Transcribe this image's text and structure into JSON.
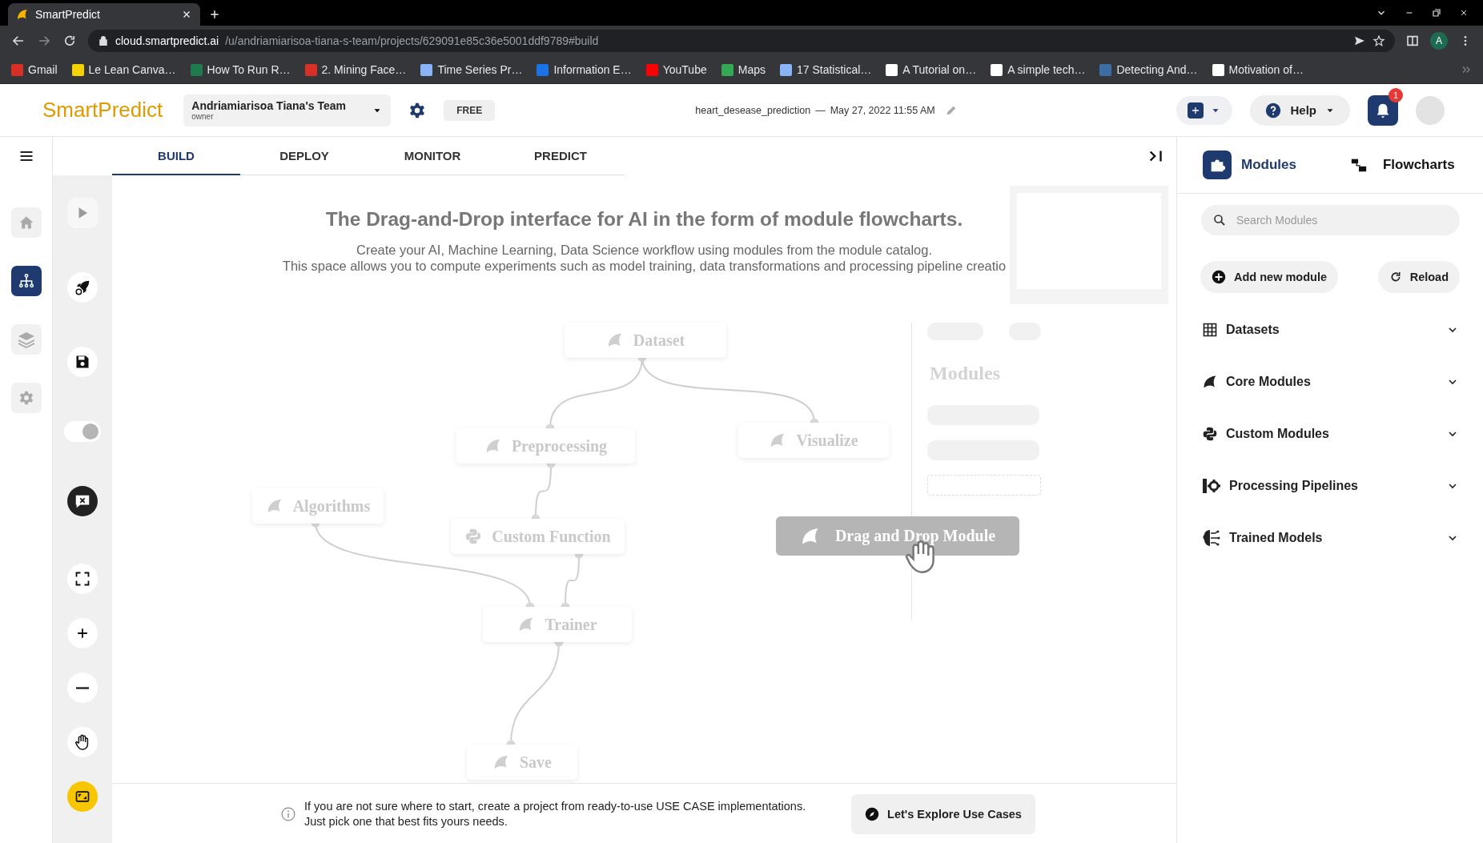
{
  "browser": {
    "tabs": [
      {
        "title": "SmartPredict",
        "selected": true
      }
    ],
    "url_host": "cloud.smartpredict.ai",
    "url_path": "/u/andriamiarisoa-tiana-s-team/projects/629091e85c36e5001ddf9789#build",
    "profile_initial": "A",
    "bookmarks": [
      "Gmail",
      "Le Lean Canva…",
      "How To Run R…",
      "2. Mining Face…",
      "Time Series Pr…",
      "Information E…",
      "YouTube",
      "Maps",
      "17 Statistical…",
      "A Tutorial on…",
      "A simple tech…",
      "Detecting And…",
      "Motivation of…"
    ]
  },
  "header": {
    "logo": "SmartPredict",
    "team": "Andriamiarisoa Tiana's Team",
    "role": "owner",
    "plan": "FREE",
    "project": "heart_desease_prediction",
    "separator": "—",
    "date": "May 27, 2022 11:55 AM",
    "help": "Help",
    "notifications": "1"
  },
  "nav": [
    {
      "kind": "home",
      "selected": false
    },
    {
      "kind": "flowchart",
      "selected": true
    },
    {
      "kind": "layers",
      "selected": false
    },
    {
      "kind": "settings",
      "selected": false
    }
  ],
  "tabs": [
    {
      "label": "BUILD",
      "selected": true
    },
    {
      "label": "DEPLOY",
      "selected": false
    },
    {
      "label": "MONITOR",
      "selected": false
    },
    {
      "label": "PREDICT",
      "selected": false
    }
  ],
  "toolbar": [
    {
      "kind": "run",
      "disabled": true,
      "active": false
    },
    {
      "kind": "deploy",
      "disabled": false,
      "active": false
    },
    {
      "kind": "save",
      "disabled": false,
      "active": false
    },
    {
      "kind": "switch",
      "on": true
    },
    {
      "kind": "comments",
      "disabled": false,
      "active": false
    },
    {
      "kind": "fullscreen",
      "disabled": false,
      "active": false
    },
    {
      "kind": "zoom-in",
      "disabled": false,
      "active": false
    },
    {
      "kind": "zoom-out",
      "disabled": false,
      "active": false
    },
    {
      "kind": "pan",
      "disabled": false,
      "active": false
    },
    {
      "kind": "fit",
      "disabled": false,
      "active": true
    }
  ],
  "canvas": {
    "heading": "The Drag-and-Drop interface for AI in the form of module flowcharts.",
    "description": [
      "Create your AI, Machine Learning, Data Science workflow using modules from the module catalog.",
      "This space allows you to compute experiments such as model training, data transformations and processing pipeline creatio"
    ],
    "nodes": [
      {
        "label": "Dataset",
        "kind": "core"
      },
      {
        "label": "Preprocessing",
        "kind": "core"
      },
      {
        "label": "Visualize",
        "kind": "core"
      },
      {
        "label": "Algorithms",
        "kind": "core"
      },
      {
        "label": "Custom Function",
        "kind": "custom"
      },
      {
        "label": "Trainer",
        "kind": "core"
      },
      {
        "label": "Save",
        "kind": "core"
      }
    ],
    "drag_module": "Drag and Drop Module",
    "catalog_title": "Modules"
  },
  "panel": {
    "tabs": [
      {
        "label": "Modules",
        "selected": true
      },
      {
        "label": "Flowcharts",
        "selected": false
      }
    ],
    "search": {
      "placeholder": "Search Modules"
    },
    "add_button": "Add new module",
    "reload_button": "Reload",
    "sections": [
      {
        "label": "Datasets",
        "kind": "datasets",
        "expanded": false
      },
      {
        "label": "Core Modules",
        "kind": "core",
        "expanded": false
      },
      {
        "label": "Custom Modules",
        "kind": "custom",
        "expanded": false
      },
      {
        "label": "Processing Pipelines",
        "kind": "pipelines",
        "expanded": false
      },
      {
        "label": "Trained Models",
        "kind": "models",
        "expanded": false
      }
    ]
  },
  "banner": {
    "lines": [
      "If you are not sure where to start, create a project from ready-to-use USE CASE implementations.",
      "Just pick one that best fits yours needs."
    ],
    "button": "Let's Explore Use Cases"
  }
}
